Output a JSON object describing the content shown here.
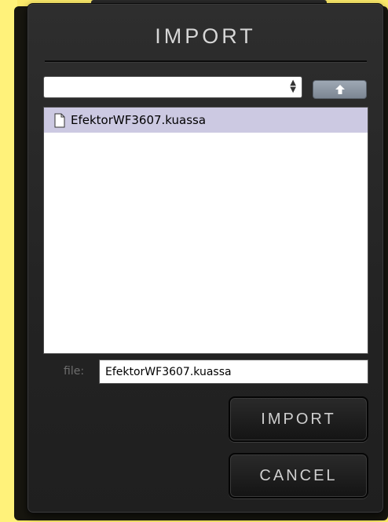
{
  "dialog": {
    "title": "IMPORT",
    "path_select_value": "",
    "up_icon": "up-arrow-icon",
    "files": [
      {
        "name": "EfektorWF3607.kuassa",
        "icon": "file-icon",
        "selected": true
      }
    ],
    "file_label": "file:",
    "file_value": "EfektorWF3607.kuassa",
    "import_label": "IMPORT",
    "cancel_label": "CANCEL"
  },
  "colors": {
    "background": "#fbe96a",
    "dialog": "#262626",
    "selection": "#ccc9e2",
    "button_text": "#cfcfcf"
  }
}
